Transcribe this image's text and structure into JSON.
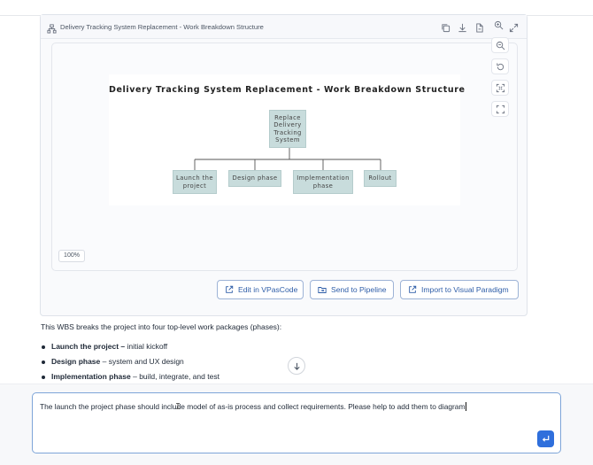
{
  "card": {
    "title": "Delivery Tracking System Replacement - Work Breakdown Structure",
    "header_icons": [
      "hierarchy-icon",
      "copy-icon",
      "download-icon",
      "export-file-icon",
      "zoom-in-icon",
      "expand-icon"
    ]
  },
  "canvas": {
    "tools": [
      "zoom-out-icon",
      "reset-icon",
      "fit-icon",
      "fullscreen-icon"
    ],
    "zoom_label": "100%"
  },
  "diagram": {
    "title": "Delivery Tracking System Replacement - Work Breakdown Structure",
    "root": "Replace Delivery Tracking System",
    "children": [
      "Launch the project",
      "Design phase",
      "Implementation phase",
      "Rollout"
    ],
    "node_color": "#c8dcdc"
  },
  "actions": {
    "edit": "Edit in VPasCode",
    "pipeline": "Send to Pipeline",
    "import": "Import to Visual Paradigm"
  },
  "message": {
    "intro": "This WBS breaks the project into four top-level work packages (phases):",
    "bullets": [
      {
        "bold": "Launch the project –",
        "rest": " initial kickoff"
      },
      {
        "bold": "Design phase",
        "rest": " – system and UX design"
      },
      {
        "bold": "Implementation phase",
        "rest": " – build, integrate, and test"
      }
    ]
  },
  "input": {
    "value": "The launch the project phase should include model of as-is process and collect requirements. Please help to add them to diagram"
  },
  "colors": {
    "accent": "#2f6fdc",
    "button_text": "#2f5ea8"
  }
}
